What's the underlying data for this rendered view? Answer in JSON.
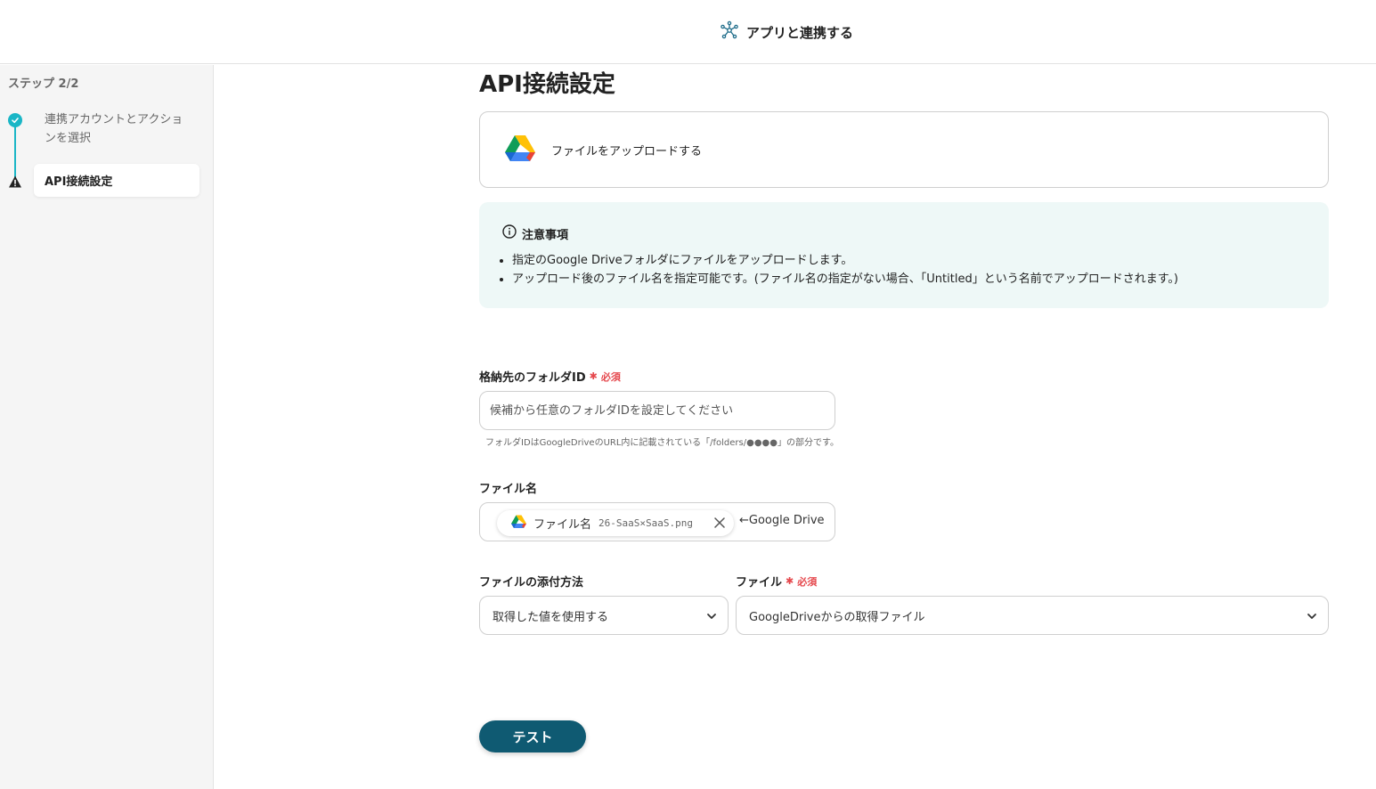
{
  "header": {
    "title": "アプリと連携する",
    "icon": "network-hub-icon"
  },
  "sidebar": {
    "step_label": "ステップ 2/2",
    "steps": [
      {
        "label": "連携アカウントとアクションを選択",
        "status": "done"
      },
      {
        "label": "API接続設定",
        "status": "active-warning"
      }
    ]
  },
  "page": {
    "title": "API接続設定"
  },
  "action": {
    "label": "ファイルをアップロードする",
    "app_icon": "google-drive-icon"
  },
  "notice": {
    "title": "注意事項",
    "items": [
      "指定のGoogle Driveフォルダにファイルをアップロードします。",
      "アップロード後のファイル名を指定可能です。(ファイル名の指定がない場合、「Untitled」という名前でアップロードされます。)"
    ]
  },
  "folder_field": {
    "label": "格納先のフォルダID",
    "required": "必須",
    "placeholder": "候補から任意のフォルダIDを設定してください",
    "hint": "フォルダIDはGoogleDriveのURL内に記載されている「/folders/●●●●」の部分です。"
  },
  "filename_field": {
    "label": "ファイル名",
    "chip_label": "ファイル名",
    "chip_value": "26-SaaS×SaaS.png",
    "trailing_text": "←Google Drive"
  },
  "attach_method_field": {
    "label": "ファイルの添付方法",
    "value": "取得した値を使用する"
  },
  "file_field": {
    "label": "ファイル",
    "required": "必須",
    "value": "GoogleDriveからの取得ファイル"
  },
  "test_button": {
    "label": "テスト",
    "color": "#0f5a72"
  },
  "colors": {
    "accent": "#1ab6c6",
    "required": "#e5484d",
    "notice_bg": "#eef8f7"
  }
}
